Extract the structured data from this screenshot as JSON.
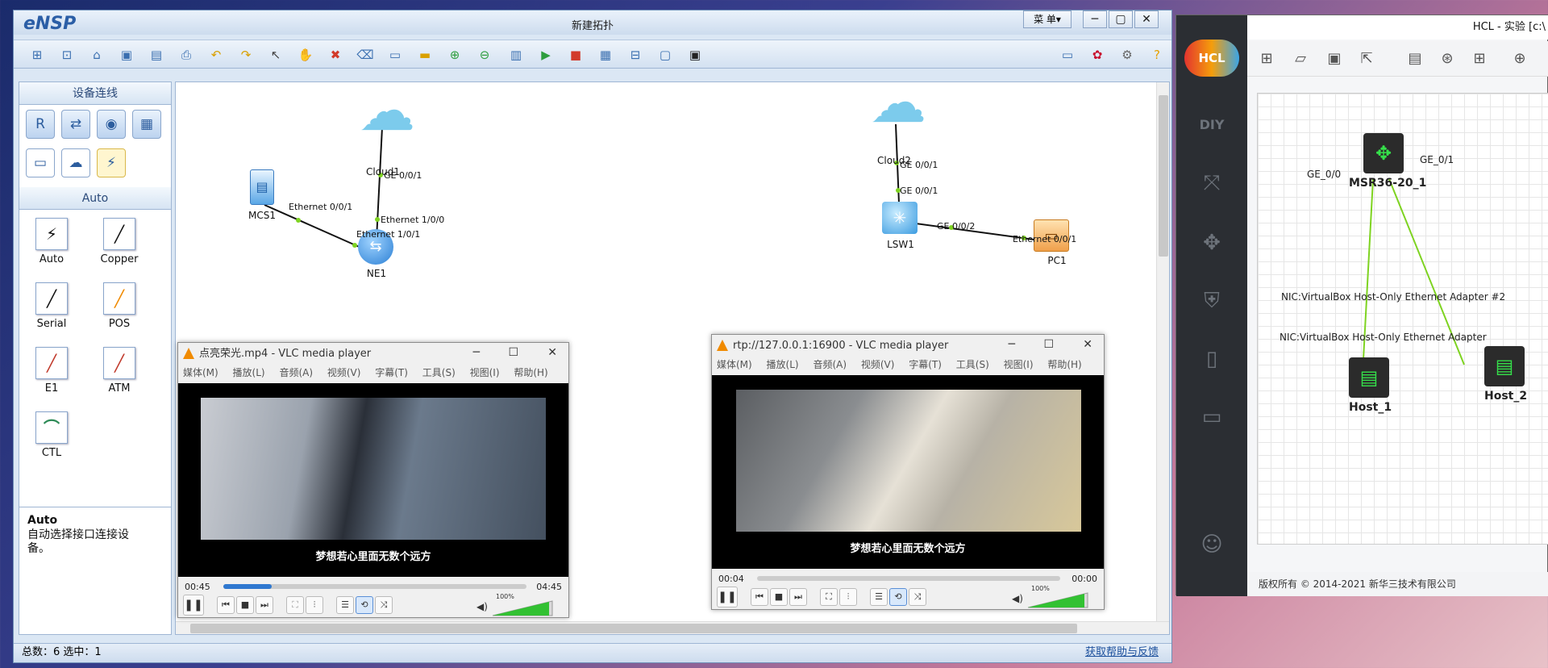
{
  "ensp": {
    "logo": "eNSP",
    "title": "新建拓扑",
    "menu_label": "菜 单▾",
    "win_buttons": [
      "─",
      "▢",
      "✕"
    ],
    "toolbar_icons": [
      "new-topology",
      "new-example",
      "open",
      "save",
      "save-as",
      "print",
      "undo",
      "redo",
      "select",
      "pan",
      "delete",
      "delete-all",
      "text",
      "palette",
      "zoom-in",
      "zoom-out",
      "fit",
      "start",
      "stop",
      "capture",
      "topology",
      "fullscreen",
      "snapshot",
      "chat",
      "huawei",
      "settings",
      "help"
    ],
    "left_panel": {
      "devices_header": "设备连线",
      "cable_header": "Auto",
      "cables": [
        {
          "label": "Auto",
          "glyph": "⚡",
          "color": "#111111"
        },
        {
          "label": "Copper",
          "glyph": "╱",
          "color": "#111111"
        },
        {
          "label": "Serial",
          "glyph": "╱",
          "color": "#111111"
        },
        {
          "label": "POS",
          "glyph": "╱",
          "color": "#f08a00"
        },
        {
          "label": "E1",
          "glyph": "╱",
          "color": "#c0392b"
        },
        {
          "label": "ATM",
          "glyph": "╱",
          "color": "#c0392b"
        },
        {
          "label": "CTL",
          "glyph": "⌒",
          "color": "#2e8b57"
        }
      ],
      "desc_title": "Auto",
      "desc_text": "自动选择接口连接设备。"
    },
    "topology": {
      "nodes": {
        "cloud1": "Cloud1",
        "mcs1": "MCS1",
        "ne1": "NE1",
        "cloud2": "Cloud2",
        "lsw1": "LSW1",
        "pc1": "PC1"
      },
      "ports": {
        "c1_ge": "GE 0/0/1",
        "mcs_eth": "Ethernet 0/0/1",
        "ne_eth100": "Ethernet 1/0/0",
        "ne_eth101": "Ethernet 1/0/1",
        "c2_ge": "GE 0/0/1",
        "lsw_ge1": "GE 0/0/1",
        "lsw_ge2": "GE 0/0/2",
        "pc_eth": "Ethernet 0/0/1"
      }
    },
    "status": {
      "total": "总数：6  选中：1",
      "help_link": "获取帮助与反馈"
    }
  },
  "vlc1": {
    "title": "点亮荣光.mp4 - VLC media player",
    "menu": [
      "媒体(M)",
      "播放(L)",
      "音频(A)",
      "视频(V)",
      "字幕(T)",
      "工具(S)",
      "视图(I)",
      "帮助(H)"
    ],
    "subtitle": "梦想若心里面无数个远方",
    "elapsed": "00:45",
    "total": "04:45",
    "progress": 0.16,
    "volume": "100%"
  },
  "vlc2": {
    "title": "rtp://127.0.0.1:16900 - VLC media player",
    "menu": [
      "媒体(M)",
      "播放(L)",
      "音频(A)",
      "视频(V)",
      "字幕(T)",
      "工具(S)",
      "视图(I)",
      "帮助(H)"
    ],
    "subtitle": "梦想若心里面无数个远方",
    "elapsed": "00:04",
    "total": "00:00",
    "progress": 0.0,
    "volume": "100%"
  },
  "hcl": {
    "logo": "HCL",
    "title": "HCL - 实验 [c:\\",
    "router": "MSR36-20_1",
    "router_port_left": "GE_0/0",
    "router_port_right": "GE_0/1",
    "nic2": "NIC:VirtualBox Host-Only Ethernet Adapter #2",
    "nic1": "NIC:VirtualBox Host-Only Ethernet Adapter",
    "host1": "Host_1",
    "host2": "Host_2",
    "footer": "版权所有 © 2014-2021 新华三技术有限公司"
  }
}
